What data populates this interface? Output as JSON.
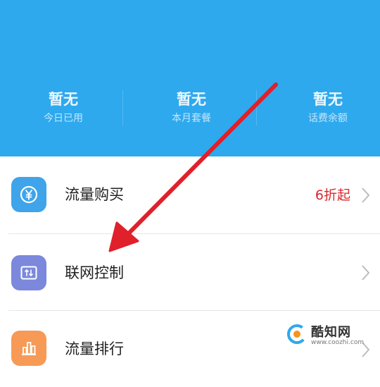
{
  "header": {
    "background": "#2ea9ee",
    "stats": [
      {
        "value": "暂无",
        "label": "今日已用"
      },
      {
        "value": "暂无",
        "label": "本月套餐"
      },
      {
        "value": "暂无",
        "label": "话费余额"
      }
    ]
  },
  "menu": {
    "items": [
      {
        "label": "流量购买",
        "icon": "yen-icon",
        "icon_color": "#3fa4ea",
        "tag": "6折起"
      },
      {
        "label": "联网控制",
        "icon": "network-toggle-icon",
        "icon_color": "#7b88dc",
        "tag": ""
      },
      {
        "label": "流量排行",
        "icon": "bar-chart-icon",
        "icon_color": "#f79a55",
        "tag": ""
      }
    ]
  },
  "annotation": {
    "color": "#e0202a",
    "icon": "red-arrow"
  },
  "watermark": {
    "name": "酷知网",
    "url": "www.coozhi.com"
  }
}
